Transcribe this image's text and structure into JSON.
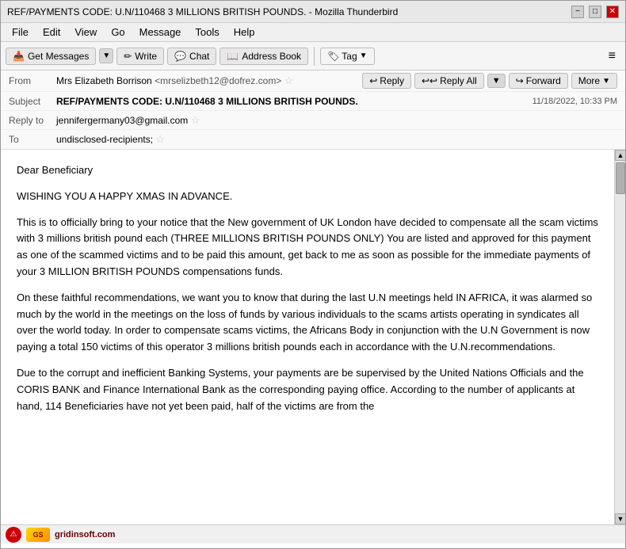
{
  "window": {
    "title": "REF/PAYMENTS CODE: U.N/110468 3 MILLIONS BRITISH POUNDS. - Mozilla Thunderbird",
    "controls": {
      "minimize": "−",
      "maximize": "□",
      "close": "✕"
    }
  },
  "menubar": {
    "items": [
      "File",
      "Edit",
      "View",
      "Go",
      "Message",
      "Tools",
      "Help"
    ]
  },
  "toolbar": {
    "get_messages_label": "Get Messages",
    "write_label": "Write",
    "chat_label": "Chat",
    "address_book_label": "Address Book",
    "tag_label": "Tag",
    "menu_icon": "≡"
  },
  "email": {
    "from_label": "From",
    "from_name": "Mrs Elizabeth Borrison",
    "from_email": "<mrselizbeth12@dofrez.com>",
    "subject_label": "Subject",
    "subject": "REF/PAYMENTS CODE: U.N/110468 3 MILLIONS BRITISH POUNDS.",
    "reply_to_label": "Reply to",
    "reply_to": "jennifergermany03@gmail.com",
    "to_label": "To",
    "to_value": "undisclosed-recipients;",
    "timestamp": "11/18/2022, 10:33 PM",
    "actions": {
      "reply": "Reply",
      "reply_all": "Reply All",
      "forward": "Forward",
      "more": "More"
    },
    "body": {
      "para1": "Dear Beneficiary",
      "para2": "WISHING YOU A HAPPY XMAS IN ADVANCE.",
      "para3": "This is to officially bring to your notice that the New government of UK London have decided to compensate all the scam victims with 3 millions british pound each (THREE MILLIONS BRITISH POUNDS ONLY) You are listed and approved for this payment as one of the scammed victims and to be paid this amount, get back to me as soon as possible for the immediate payments of your 3 MILLION BRITISH POUNDS compensations funds.",
      "para4": "On these faithful recommendations, we want you to know that during the last U.N meetings held IN AFRICA, it was alarmed so much by the world in the meetings on the loss of funds by various individuals to the scams artists operating in syndicates all over the world today. In order to compensate scams victims, the Africans Body in conjunction with the U.N Government is now paying a total 150 victims of this operator 3 millions british pounds each in accordance with the U.N.recommendations.",
      "para5": "Due to the corrupt and inefficient Banking Systems, your payments are be supervised by the United Nations Officials and the CORIS BANK and Finance International Bank as the corresponding paying office. According to the number of applicants at hand, 114 Beneficiaries have not yet been paid, half of the victims are from the"
    }
  }
}
